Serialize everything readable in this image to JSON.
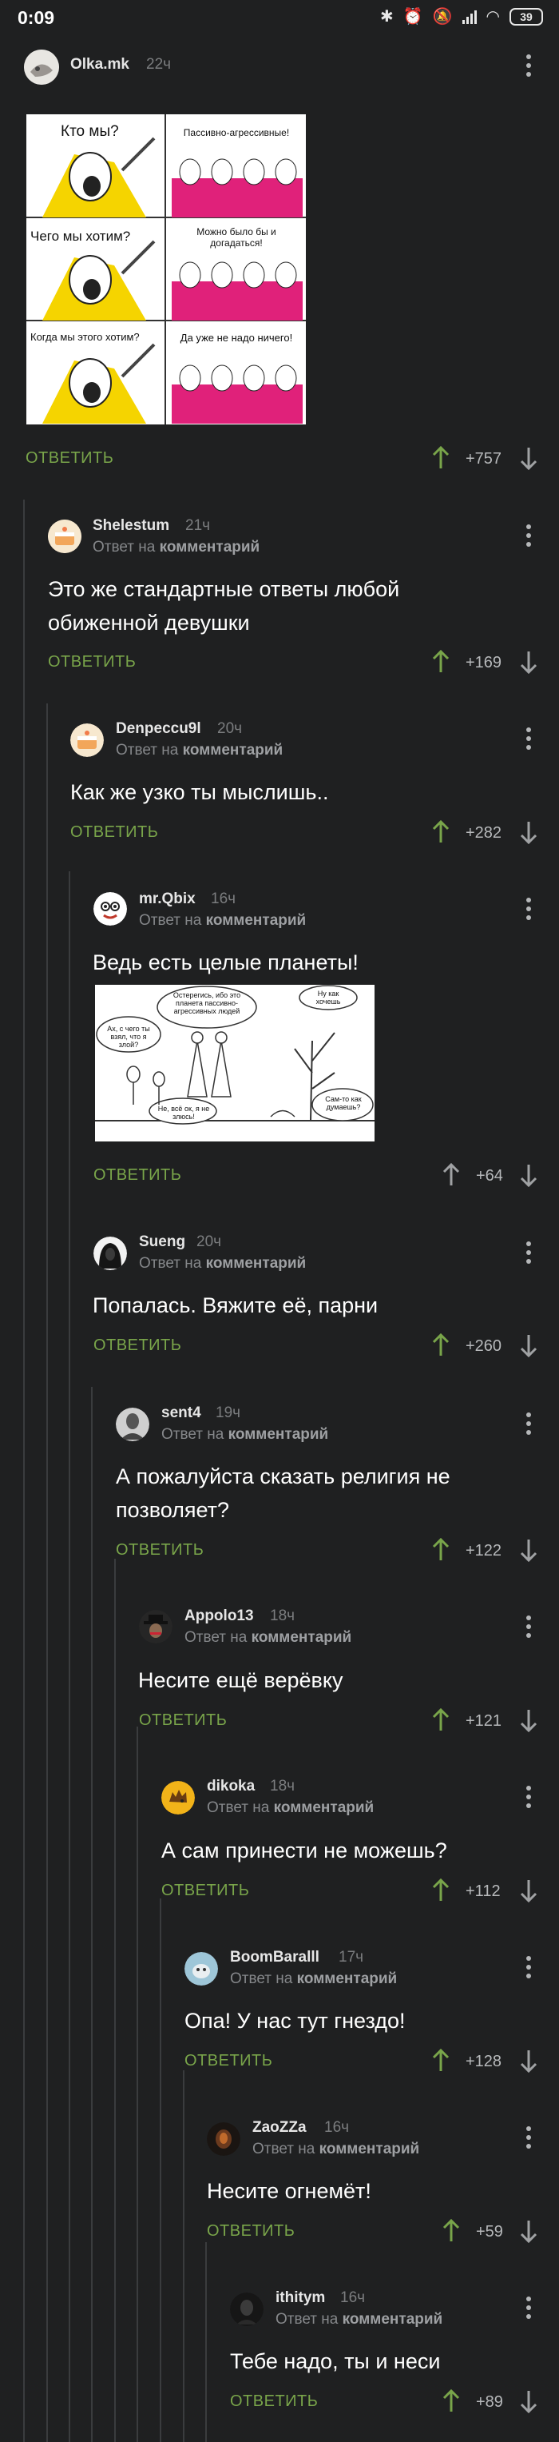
{
  "status_bar": {
    "time": "0:09",
    "battery": "39"
  },
  "colors": {
    "background": "#1f2021",
    "accent_green": "#79a54a",
    "up_active": "#79a54a",
    "up_inactive": "#a0a2a4"
  },
  "post": {
    "author": "Olka.mk",
    "age": "22ч",
    "answer": "ОТВЕТИТЬ",
    "score": "+757",
    "meme": {
      "rows": [
        {
          "left": "Кто мы?",
          "right": "Пассивно-агрессивные!"
        },
        {
          "left": "Чего мы хотим?",
          "right": "Можно было бы и догадаться!"
        },
        {
          "left": "Когда мы этого хотим?",
          "right": "Да уже не надо ничего!"
        }
      ]
    }
  },
  "reply_prefix": "Ответ на",
  "reply_target": "комментарий",
  "comments": [
    {
      "author": "Shelestum",
      "age": "21ч",
      "text": "Это же стандартные ответы любой обиженной девушки",
      "answer": "ОТВЕТИТЬ",
      "score": "+169",
      "avatar_icon": "cake-avatar-icon"
    },
    {
      "author": "Denpeccu9l",
      "age": "20ч",
      "text": "Как же узко ты мыслишь..",
      "answer": "ОТВЕТИТЬ",
      "score": "+282",
      "avatar_icon": "cake-avatar-icon"
    },
    {
      "author": "mr.Qbix",
      "age": "16ч",
      "text": "Ведь есть целые планеты!",
      "answer": "ОТВЕТИТЬ",
      "score": "+64",
      "avatar_icon": "cartoon-avatar-icon",
      "comic": {
        "bubble_left": "Ах, с чего ты взял, что я злой?",
        "bubble_mid": "Остерегись, ибо это планета пассивно-агрессивных людей",
        "bubble_right": "Ну как хочешь",
        "bubble_bl": "Не, всё ок, я не злюсь!",
        "bubble_br": "Сам-то как думаешь?"
      }
    },
    {
      "author": "Sueng",
      "age": "20ч",
      "text": "Попалась. Вяжите её, парни",
      "answer": "ОТВЕТИТЬ",
      "score": "+260",
      "avatar_icon": "dark-hood-avatar-icon"
    },
    {
      "author": "sent4",
      "age": "19ч",
      "text": "А пожалуйста сказать религия не позволяет?",
      "answer": "ОТВЕТИТЬ",
      "score": "+122",
      "avatar_icon": "photo-avatar-icon"
    },
    {
      "author": "Appolo13",
      "age": "18ч",
      "text": "Несите ещё верёвку",
      "answer": "ОТВЕТИТЬ",
      "score": "+121",
      "avatar_icon": "hat-avatar-icon"
    },
    {
      "author": "dikoka",
      "age": "18ч",
      "text": "А сам принести не можешь?",
      "answer": "ОТВЕТИТЬ",
      "score": "+112",
      "avatar_icon": "hedgehog-avatar-icon"
    },
    {
      "author": "BoomBaralll",
      "age": "17ч",
      "text": "Опа! У нас тут гнездо!",
      "answer": "ОТВЕТИТЬ",
      "score": "+128",
      "avatar_icon": "sky-avatar-icon"
    },
    {
      "author": "ZaoZZa",
      "age": "16ч",
      "text": "Несите огнемёт!",
      "answer": "ОТВЕТИТЬ",
      "score": "+59",
      "avatar_icon": "dark-avatar-icon"
    },
    {
      "author": "ithitym",
      "age": "16ч",
      "text": "Тебе надо, ты и неси",
      "answer": "ОТВЕТИТЬ",
      "score": "+89",
      "avatar_icon": "dark-avatar-icon"
    }
  ]
}
